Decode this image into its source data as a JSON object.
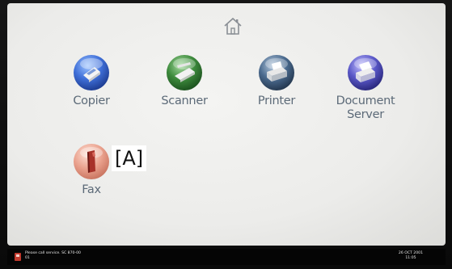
{
  "home": {
    "icon": "home-icon"
  },
  "apps": [
    {
      "label": "Copier",
      "icon": "copier-icon",
      "color": "#3f6fd8"
    },
    {
      "label": "Scanner",
      "icon": "scanner-icon",
      "color": "#3d8a3c"
    },
    {
      "label": "Printer",
      "icon": "printer-icon",
      "color": "#4a6a8e"
    },
    {
      "label": "Document\nServer",
      "icon": "document-server-icon",
      "color": "#5a58c8"
    },
    {
      "label": "Fax",
      "icon": "fax-icon",
      "color": "#e9a08c"
    }
  ],
  "callout": {
    "text": "[A]"
  },
  "status": {
    "message_line1": "Please call service. SC 870-00",
    "message_line2": "01",
    "date": "26 OCT 2001",
    "time": "11:05"
  },
  "colors": {
    "screen": "#eeeeec",
    "label": "#5c6a78",
    "statusbar": "#050505"
  }
}
